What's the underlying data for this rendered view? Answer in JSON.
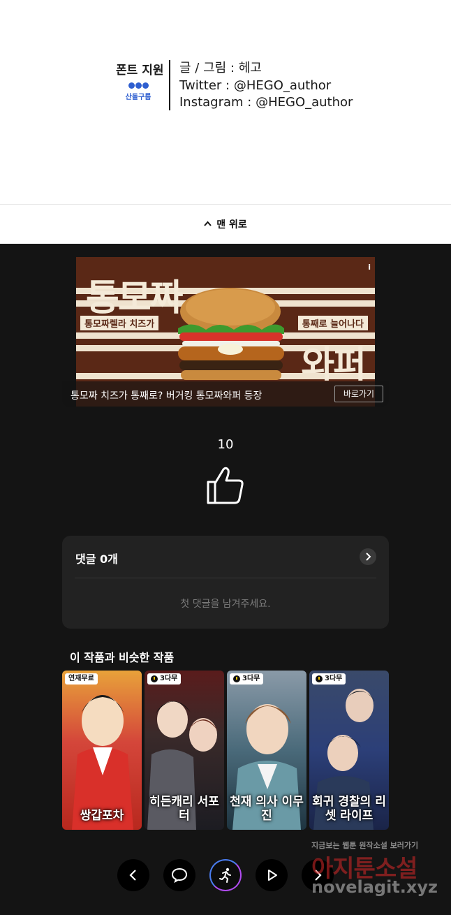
{
  "credits": {
    "font_label": "폰트 지원",
    "font_logo_text": "산돌구름",
    "line1": "글 / 그림 : 헤고",
    "line2": "Twitter : @HEGO_author",
    "line3": "Instagram : @HEGO_author"
  },
  "topbar": {
    "label": "맨 위로",
    "icon": "caret-up-icon"
  },
  "ad": {
    "banner_title_left": "통모짜",
    "banner_title_right": "와퍼",
    "banner_tag_left": "통모짜렐라 치즈가",
    "banner_tag_right": "통째로 늘어나다",
    "info_mark": "i",
    "caption": "통모짜 치즈가 통째로? 버거킹 통모짜와퍼 등장",
    "cta": "바로가기",
    "colors": {
      "banner_bg": "#5a2816",
      "stripe": "#efe3cf"
    }
  },
  "likes": {
    "count": "10",
    "icon": "thumbs-up-icon"
  },
  "comments": {
    "title": "댓글 0개",
    "empty_text": "첫 댓글을 남겨주세요.",
    "arrow_icon": "chevron-right-icon"
  },
  "similar": {
    "title": "이 작품과 비슷한 작품",
    "items": [
      {
        "name": "쌍갑포차",
        "badge": "연재무료",
        "badge_icon": "",
        "bg": "#c63a2c"
      },
      {
        "name": "히든캐리 서포터",
        "badge": "3다무",
        "badge_icon": "clock-icon",
        "bg": "#2b2b33"
      },
      {
        "name": "천재 의사 이무진",
        "badge": "3다무",
        "badge_icon": "clock-icon",
        "bg": "#3c5a6a"
      },
      {
        "name": "회귀 경찰의 리셋 라이프",
        "badge": "3다무",
        "badge_icon": "clock-icon",
        "bg": "#2c3f78"
      }
    ]
  },
  "bottom_nav": {
    "items": [
      "chevron-left-icon",
      "chat-bubble-icon",
      "runner-icon",
      "play-icon",
      "chevron-right-icon"
    ]
  },
  "watermark": {
    "small": "지금보는 웹툰 원작소설 보러가기",
    "big": "아지툰소설",
    "url": "novelagit.xyz"
  }
}
